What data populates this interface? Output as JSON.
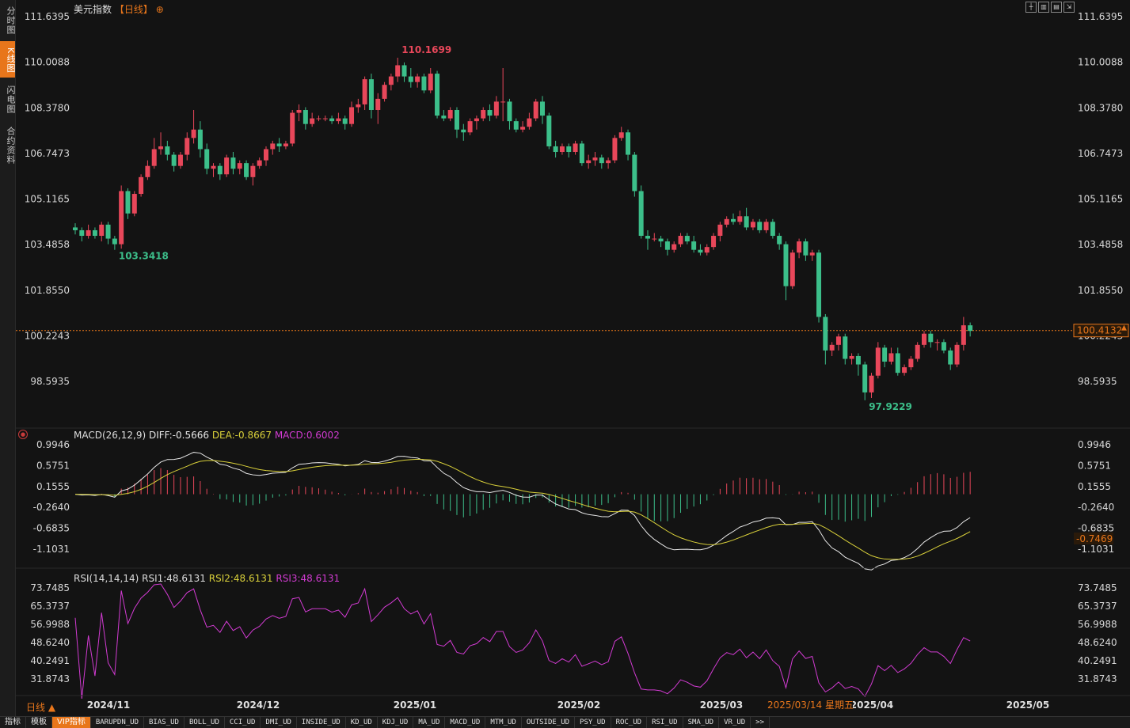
{
  "sidebar": {
    "tabs": [
      {
        "label": "分时图",
        "active": false
      },
      {
        "label": "K线图",
        "active": true
      },
      {
        "label": "闪电图",
        "active": false
      },
      {
        "label": "合约资料",
        "active": false
      }
    ]
  },
  "header": {
    "title": "美元指数",
    "period": "【日线】",
    "add_icon": "plus-circle-icon",
    "tools": [
      "crosshair-icon",
      "layout-icon",
      "window-icon",
      "restore-icon"
    ]
  },
  "price_axis": {
    "labels": [
      "111.6395",
      "110.0088",
      "108.3780",
      "106.7473",
      "105.1165",
      "103.4858",
      "101.8550",
      "100.2243",
      "98.5935"
    ],
    "current_price": "100.4132",
    "high_label": "110.1699",
    "low_label_1": "103.3418",
    "low_label_2": "97.9229"
  },
  "macd": {
    "title": "MACD(26,12,9)",
    "diff_label": "DIFF:-0.5666",
    "dea_label": "DEA:-0.8667",
    "macd_label": "MACD:0.6002",
    "axis_labels": [
      "0.9946",
      "0.5751",
      "0.1555",
      "-0.2640",
      "-0.6835",
      "-1.1031"
    ],
    "current_value": "-0.7469"
  },
  "rsi": {
    "title": "RSI(14,14,14)",
    "rsi1_label": "RSI1:48.6131",
    "rsi2_label": "RSI2:48.6131",
    "rsi3_label": "RSI3:48.6131",
    "axis_labels": [
      "73.7485",
      "65.3737",
      "56.9988",
      "48.6240",
      "40.2491",
      "31.8743"
    ]
  },
  "time_axis": {
    "labels": [
      "2024/11",
      "2024/12",
      "2025/01",
      "2025/02",
      "2025/03",
      "2025/04",
      "2025/05"
    ],
    "cursor_date": "2025/03/14 星期五"
  },
  "period_selector": "日线 ▲",
  "bottom_tabs": [
    "指标",
    "模板",
    "VIP指标",
    "BARUPDN_UD",
    "BIAS_UD",
    "BOLL_UD",
    "CCI_UD",
    "DMI_UD",
    "INSIDE_UD",
    "KD_UD",
    "KDJ_UD",
    "MA_UD",
    "MACD_UD",
    "MTM_UD",
    "OUTSIDE_UD",
    "PSY_UD",
    "ROC_UD",
    "RSI_UD",
    "SMA_UD",
    "VR_UD",
    ">>"
  ],
  "colors": {
    "up": "#e8475a",
    "down": "#3cbf8a",
    "accent": "#e8761b",
    "diff_line": "#e8e8e8",
    "dea_line": "#d9d03a",
    "rsi_line": "#d23bd2",
    "macd_label_color": "#d23bd2"
  },
  "chart_data": {
    "type": "candlestick",
    "price_range": [
      97.9229,
      110.1699
    ],
    "axis_ticks": [
      111.6395,
      110.0088,
      108.378,
      106.7473,
      105.1165,
      103.4858,
      101.855,
      100.2243,
      98.5935
    ],
    "last_close": 100.4132,
    "high": 110.1699,
    "low": 97.9229,
    "candles": [
      [
        104.1,
        104.0,
        104.25,
        103.85
      ],
      [
        104.0,
        103.8,
        104.1,
        103.6
      ],
      [
        103.8,
        104.0,
        104.2,
        103.7
      ],
      [
        104.0,
        103.8,
        104.1,
        103.7
      ],
      [
        103.8,
        104.2,
        104.3,
        103.6
      ],
      [
        104.2,
        103.7,
        104.3,
        103.5
      ],
      [
        103.7,
        103.5,
        103.8,
        103.3
      ],
      [
        103.5,
        105.4,
        105.6,
        103.34
      ],
      [
        105.4,
        104.6,
        105.5,
        104.4
      ],
      [
        104.6,
        105.3,
        105.4,
        104.5
      ],
      [
        105.3,
        105.9,
        106.0,
        105.2
      ],
      [
        105.9,
        106.3,
        106.5,
        105.8
      ],
      [
        106.3,
        106.9,
        107.3,
        106.2
      ],
      [
        106.9,
        107.0,
        107.5,
        106.7
      ],
      [
        107.0,
        106.7,
        107.2,
        106.5
      ],
      [
        106.7,
        106.3,
        106.8,
        106.1
      ],
      [
        106.3,
        106.7,
        106.8,
        106.2
      ],
      [
        106.7,
        107.3,
        107.5,
        106.5
      ],
      [
        107.3,
        107.6,
        108.3,
        107.1
      ],
      [
        107.6,
        106.9,
        107.9,
        106.6
      ],
      [
        106.9,
        106.2,
        107.1,
        106.0
      ],
      [
        106.2,
        106.3,
        106.4,
        105.9
      ],
      [
        106.3,
        106.0,
        106.4,
        105.8
      ],
      [
        106.0,
        106.6,
        106.7,
        105.9
      ],
      [
        106.6,
        106.2,
        106.8,
        106.0
      ],
      [
        106.2,
        106.4,
        106.5,
        106.0
      ],
      [
        106.4,
        105.9,
        106.5,
        105.8
      ],
      [
        105.9,
        106.3,
        106.4,
        105.6
      ],
      [
        106.3,
        106.5,
        106.6,
        106.2
      ],
      [
        106.5,
        106.9,
        107.0,
        106.3
      ],
      [
        106.9,
        107.1,
        107.2,
        106.7
      ],
      [
        107.1,
        107.0,
        107.3,
        106.8
      ],
      [
        107.0,
        107.1,
        107.2,
        106.9
      ],
      [
        107.1,
        108.2,
        108.3,
        107.0
      ],
      [
        108.2,
        108.3,
        108.5,
        107.9
      ],
      [
        108.3,
        107.8,
        108.4,
        107.6
      ],
      [
        107.8,
        108.0,
        108.2,
        107.7
      ],
      [
        108.0,
        108.0,
        108.1,
        107.9
      ],
      [
        108.0,
        108.0,
        108.1,
        107.9
      ],
      [
        108.0,
        107.9,
        108.1,
        107.8
      ],
      [
        107.9,
        108.0,
        108.2,
        107.8
      ],
      [
        108.0,
        107.8,
        108.1,
        107.6
      ],
      [
        107.8,
        108.4,
        108.6,
        107.7
      ],
      [
        108.4,
        108.5,
        108.7,
        108.2
      ],
      [
        108.5,
        109.4,
        109.5,
        108.3
      ],
      [
        109.4,
        108.3,
        109.6,
        108.0
      ],
      [
        108.3,
        108.7,
        108.9,
        107.8
      ],
      [
        108.7,
        109.2,
        109.3,
        108.6
      ],
      [
        109.2,
        109.5,
        109.6,
        109.0
      ],
      [
        109.5,
        109.9,
        110.17,
        109.3
      ],
      [
        109.9,
        109.5,
        110.0,
        109.3
      ],
      [
        109.5,
        109.3,
        109.8,
        109.1
      ],
      [
        109.3,
        109.5,
        109.6,
        109.1
      ],
      [
        109.5,
        109.0,
        109.6,
        108.9
      ],
      [
        109.0,
        109.6,
        109.8,
        108.9
      ],
      [
        109.6,
        108.1,
        109.7,
        108.0
      ],
      [
        108.1,
        108.0,
        108.3,
        107.9
      ],
      [
        108.0,
        108.3,
        108.4,
        107.9
      ],
      [
        108.3,
        107.6,
        108.4,
        107.3
      ],
      [
        107.6,
        107.5,
        107.8,
        107.2
      ],
      [
        107.5,
        107.9,
        108.0,
        107.4
      ],
      [
        107.9,
        108.0,
        108.1,
        107.6
      ],
      [
        108.0,
        108.3,
        108.4,
        107.9
      ],
      [
        108.3,
        108.1,
        108.5,
        107.9
      ],
      [
        108.1,
        108.6,
        108.8,
        108.0
      ],
      [
        108.6,
        108.6,
        109.8,
        107.9
      ],
      [
        108.6,
        107.9,
        108.7,
        107.6
      ],
      [
        107.9,
        107.6,
        108.0,
        107.5
      ],
      [
        107.6,
        107.7,
        107.9,
        107.5
      ],
      [
        107.7,
        108.0,
        108.2,
        107.6
      ],
      [
        108.0,
        108.6,
        108.7,
        107.9
      ],
      [
        108.6,
        108.1,
        108.8,
        107.8
      ],
      [
        108.1,
        107.0,
        108.2,
        106.9
      ],
      [
        107.0,
        106.8,
        107.2,
        106.6
      ],
      [
        106.8,
        107.0,
        107.1,
        106.7
      ],
      [
        107.0,
        106.8,
        107.1,
        106.6
      ],
      [
        106.8,
        107.1,
        107.2,
        106.7
      ],
      [
        107.1,
        106.4,
        107.2,
        106.3
      ],
      [
        106.4,
        106.5,
        106.7,
        106.2
      ],
      [
        106.5,
        106.6,
        106.8,
        106.3
      ],
      [
        106.6,
        106.4,
        106.7,
        106.2
      ],
      [
        106.4,
        106.5,
        106.6,
        106.2
      ],
      [
        106.5,
        107.3,
        107.4,
        106.4
      ],
      [
        107.3,
        107.5,
        107.7,
        107.2
      ],
      [
        107.5,
        106.7,
        107.6,
        106.5
      ],
      [
        106.7,
        105.4,
        106.8,
        105.2
      ],
      [
        105.4,
        103.8,
        105.6,
        103.7
      ],
      [
        103.8,
        103.7,
        104.0,
        103.3
      ],
      [
        103.7,
        103.7,
        103.9,
        103.6
      ],
      [
        103.7,
        103.6,
        103.8,
        103.4
      ],
      [
        103.6,
        103.3,
        103.7,
        103.1
      ],
      [
        103.3,
        103.5,
        103.6,
        103.2
      ],
      [
        103.5,
        103.8,
        103.9,
        103.4
      ],
      [
        103.8,
        103.6,
        103.9,
        103.5
      ],
      [
        103.6,
        103.3,
        103.8,
        103.2
      ],
      [
        103.3,
        103.2,
        103.5,
        103.1
      ],
      [
        103.2,
        103.4,
        103.5,
        103.1
      ],
      [
        103.4,
        103.8,
        103.9,
        103.3
      ],
      [
        103.8,
        104.2,
        104.3,
        103.6
      ],
      [
        104.2,
        104.4,
        104.5,
        104.1
      ],
      [
        104.4,
        104.3,
        104.6,
        104.2
      ],
      [
        104.3,
        104.5,
        104.7,
        104.2
      ],
      [
        104.5,
        104.1,
        104.8,
        104.0
      ],
      [
        104.1,
        104.3,
        104.4,
        104.0
      ],
      [
        104.3,
        104.0,
        104.4,
        103.9
      ],
      [
        104.0,
        104.3,
        104.4,
        103.9
      ],
      [
        104.3,
        103.8,
        104.4,
        103.7
      ],
      [
        103.8,
        103.5,
        103.9,
        103.3
      ],
      [
        103.5,
        102.0,
        103.6,
        101.5
      ],
      [
        102.0,
        103.2,
        103.3,
        101.9
      ],
      [
        103.2,
        103.6,
        103.7,
        103.0
      ],
      [
        103.6,
        103.1,
        103.7,
        102.9
      ],
      [
        103.1,
        103.2,
        103.3,
        102.9
      ],
      [
        103.2,
        100.9,
        103.3,
        100.7
      ],
      [
        100.9,
        99.7,
        101.0,
        99.2
      ],
      [
        99.7,
        99.9,
        100.0,
        99.5
      ],
      [
        99.9,
        100.2,
        100.3,
        99.7
      ],
      [
        100.2,
        99.4,
        100.3,
        99.2
      ],
      [
        99.4,
        99.5,
        99.6,
        99.2
      ],
      [
        99.5,
        99.2,
        99.6,
        98.8
      ],
      [
        99.2,
        98.2,
        99.3,
        97.92
      ],
      [
        98.2,
        98.8,
        98.9,
        98.0
      ],
      [
        98.8,
        99.8,
        100.0,
        98.7
      ],
      [
        99.8,
        99.3,
        99.9,
        99.1
      ],
      [
        99.3,
        99.6,
        99.8,
        99.2
      ],
      [
        99.6,
        98.9,
        99.8,
        98.8
      ],
      [
        98.9,
        99.1,
        99.2,
        98.8
      ],
      [
        99.1,
        99.4,
        99.5,
        99.0
      ],
      [
        99.4,
        99.9,
        100.0,
        99.3
      ],
      [
        99.9,
        100.3,
        100.4,
        99.8
      ],
      [
        100.3,
        100.0,
        100.4,
        99.8
      ],
      [
        100.0,
        100.0,
        100.1,
        99.7
      ],
      [
        100.0,
        99.7,
        100.1,
        99.6
      ],
      [
        99.7,
        99.2,
        99.8,
        99.0
      ],
      [
        99.2,
        99.9,
        100.0,
        99.1
      ],
      [
        99.9,
        100.6,
        100.9,
        99.7
      ],
      [
        100.6,
        100.4,
        100.7,
        100.2
      ]
    ]
  }
}
